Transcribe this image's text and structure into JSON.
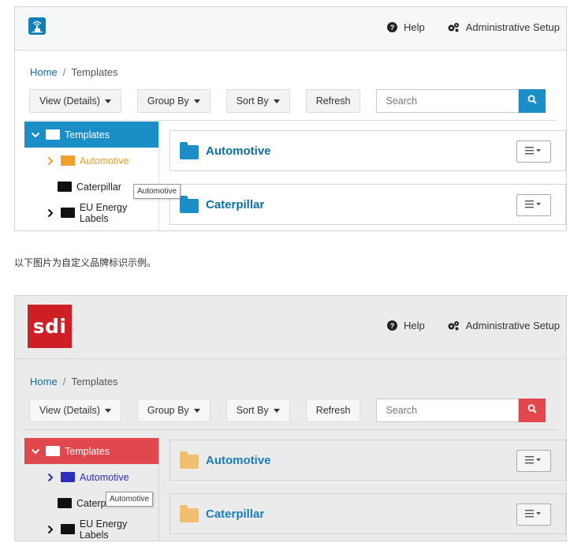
{
  "top": {
    "help_label": "Help",
    "admin_label": "Administrative Setup",
    "breadcrumb_home": "Home",
    "breadcrumb_sep": "/",
    "breadcrumb_current": "Templates",
    "view_label": "View (Details)",
    "group_label": "Group By",
    "sort_label": "Sort By",
    "refresh_label": "Refresh",
    "search_placeholder": "Search",
    "tree": {
      "root": "Templates",
      "items": [
        "Automotive",
        "Caterpillar",
        "EU Energy Labels"
      ]
    },
    "tooltip": "Automotive",
    "cards": [
      "Automotive",
      "Caterpillar"
    ],
    "colors": {
      "accent": "#1b8ec8",
      "selected_text": "#f0a030",
      "folder": "#1b8ec8"
    }
  },
  "caption": "以下图片为自定义品牌标识示例。",
  "bottom": {
    "logo_text": "sdi",
    "help_label": "Help",
    "admin_label": "Administrative Setup",
    "breadcrumb_home": "Home",
    "breadcrumb_sep": "/",
    "breadcrumb_current": "Templates",
    "view_label": "View (Details)",
    "group_label": "Group By",
    "sort_label": "Sort By",
    "refresh_label": "Refresh",
    "search_placeholder": "Search",
    "tree": {
      "root": "Templates",
      "items": [
        "Automotive",
        "Caterpillar",
        "EU Energy Labels"
      ]
    },
    "tooltip": "Automotive",
    "cards": [
      "Automotive",
      "Caterpillar"
    ],
    "colors": {
      "accent": "#e0484d",
      "selected_text": "#2d2dbf",
      "folder": "#f0c070"
    }
  },
  "icons": [
    "logo-icon",
    "question-circle-icon",
    "gears-icon",
    "search-icon",
    "chevron-down-icon",
    "chevron-right-icon",
    "folder-icon",
    "hamburger-menu-icon"
  ]
}
